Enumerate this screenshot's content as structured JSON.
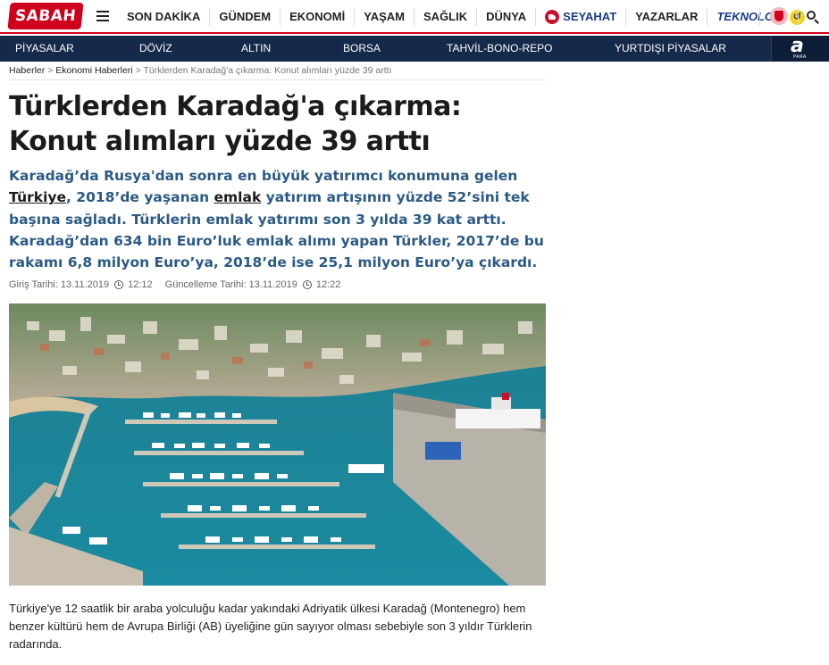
{
  "brand": {
    "logo_text": "SABAH",
    "accent": "#d0021b",
    "subnav_bg": "#15294a",
    "spot_color": "#2b5a86"
  },
  "nav": {
    "items": [
      {
        "label": "SON DAKİKA"
      },
      {
        "label": "GÜNDEM"
      },
      {
        "label": "EKONOMİ"
      },
      {
        "label": "YAŞAM"
      },
      {
        "label": "SAĞLIK"
      },
      {
        "label": "DÜNYA"
      },
      {
        "label": "SEYAHAT",
        "icon": "thy-plane-icon"
      },
      {
        "label": "YAZARLAR"
      },
      {
        "label": "TEKNOLOJİ",
        "icon": "tekno-icon"
      }
    ]
  },
  "subnav": {
    "items": [
      {
        "label": "PİYASALAR"
      },
      {
        "label": "DÖVİZ"
      },
      {
        "label": "ALTIN"
      },
      {
        "label": "BORSA"
      },
      {
        "label": "TAHVİL-BONO-REPO"
      },
      {
        "label": "YURTDIŞI PİYASALAR"
      }
    ],
    "apara": {
      "letter": "a",
      "word": "PARA"
    }
  },
  "article": {
    "breadcrumb": {
      "home": "Haberler",
      "section": "Ekonomi Haberleri",
      "current": "Türklerden Karadağ'a çıkarma: Konut alımları yüzde 39 arttı",
      "sep": ">"
    },
    "title": "Türklerden Karadağ'a çıkarma: Konut alımları yüzde 39 arttı",
    "spot": {
      "part1": "Karadağ’da Rusya'dan sonra en büyük yatırımcı konumuna gelen ",
      "link1": "Türkiye",
      "part2": ", 2018’de yaşanan ",
      "link2": "emlak",
      "part3": " yatırım artışının yüzde 52’sini tek başına sağladı. Türklerin emlak yatırımı son 3 yılda 39 kat arttı. Karadağ’dan 634 bin Euro’luk emlak alımı yapan Türkler, 2017’de bu rakamı 6,8 milyon Euro’ya, 2018’de ise 25,1 milyon Euro’ya çıkardı."
    },
    "dates": {
      "published_label": "Giriş Tarihi: 13.11.2019",
      "published_time": "12:12",
      "updated_label": "Güncelleme Tarihi: 13.11.2019",
      "updated_time": "12:22"
    },
    "body": "Türkiye'ye 12 saatlik bir araba yolculuğu kadar yakındaki Adriyatik ülkesi Karadağ (Montenegro) hem benzer kültürü hem de Avrupa Birliği (AB) üyeliğine gün sayıyor olması sebebiyle son 3 yıldır Türklerin radarında."
  }
}
